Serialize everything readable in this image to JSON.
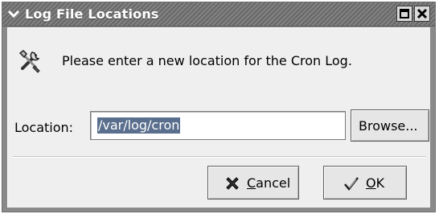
{
  "window": {
    "title": "Log File Locations",
    "menu_icon": "chevron-down-icon",
    "maximize_icon": "maximize-icon",
    "close_icon": "close-icon"
  },
  "prompt": {
    "icon": "tools-icon",
    "text": "Please enter a new location for the Cron Log."
  },
  "location": {
    "label": "Location:",
    "value": "/var/log/cron",
    "browse_label": "Browse..."
  },
  "buttons": {
    "cancel_icon": "cancel-icon",
    "cancel_mnemonic": "C",
    "cancel_rest": "ancel",
    "ok_icon": "ok-checkmark-icon",
    "ok_mnemonic": "O",
    "ok_rest": "K"
  },
  "colors": {
    "selection": "#5a6f8d",
    "titlebar": "#747474",
    "dialog_bg": "#efefef"
  }
}
